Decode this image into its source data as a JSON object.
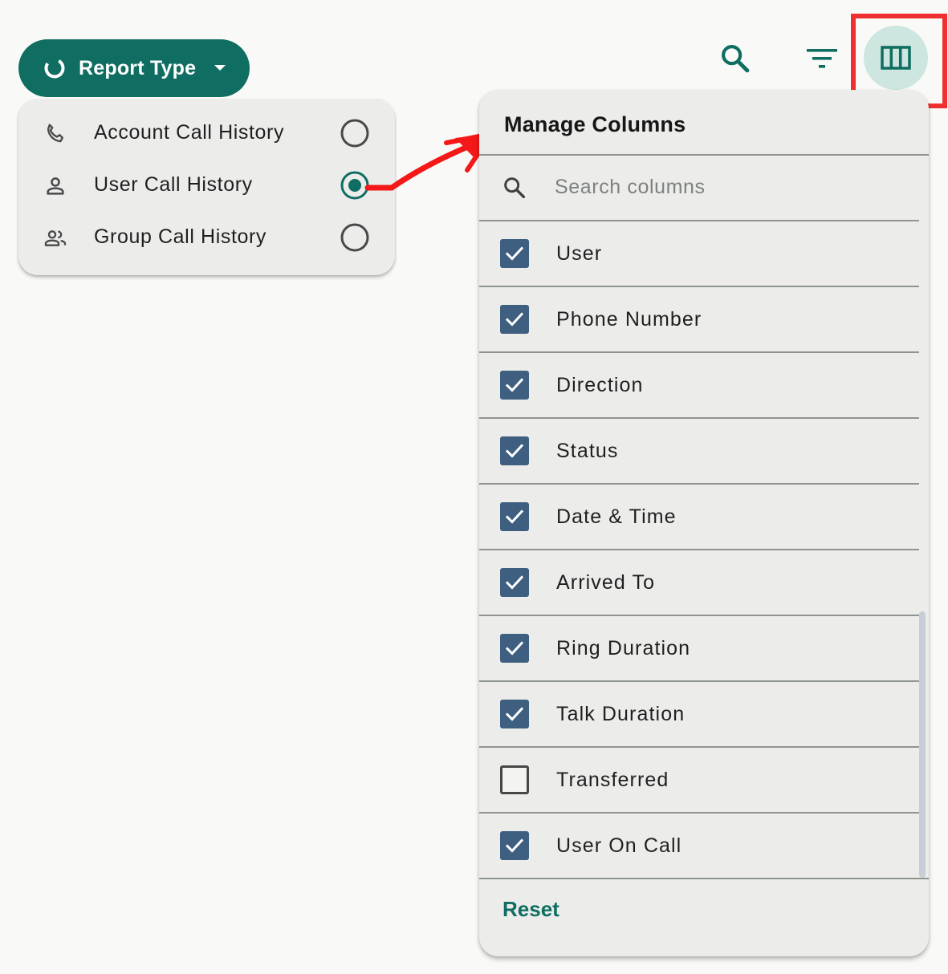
{
  "colors": {
    "brand": "#0f6d61",
    "checkbox": "#3e5f80",
    "highlight": "#f03030",
    "panel_bg": "#ecedeb",
    "column_button_bg": "#cde6e0"
  },
  "toolbar": {
    "report_type_label": "Report Type",
    "report_type_icon": "report-ring-icon",
    "search_icon": "search-icon",
    "filter_icon": "filter-icon",
    "columns_icon": "view-columns-icon"
  },
  "report_menu": {
    "items": [
      {
        "label": "Account Call History",
        "icon": "phone-icon",
        "selected": false
      },
      {
        "label": "User Call History",
        "icon": "person-icon",
        "selected": true
      },
      {
        "label": "Group Call History",
        "icon": "group-icon",
        "selected": false
      }
    ]
  },
  "columns_panel": {
    "title": "Manage Columns",
    "search_placeholder": "Search columns",
    "search_value": "",
    "columns": [
      {
        "label": "User",
        "checked": true
      },
      {
        "label": "Phone Number",
        "checked": true
      },
      {
        "label": "Direction",
        "checked": true
      },
      {
        "label": "Status",
        "checked": true
      },
      {
        "label": "Date & Time",
        "checked": true
      },
      {
        "label": "Arrived To",
        "checked": true
      },
      {
        "label": "Ring Duration",
        "checked": true
      },
      {
        "label": "Talk Duration",
        "checked": true
      },
      {
        "label": "Transferred",
        "checked": false
      },
      {
        "label": "User On Call",
        "checked": true
      }
    ],
    "reset_label": "Reset"
  }
}
